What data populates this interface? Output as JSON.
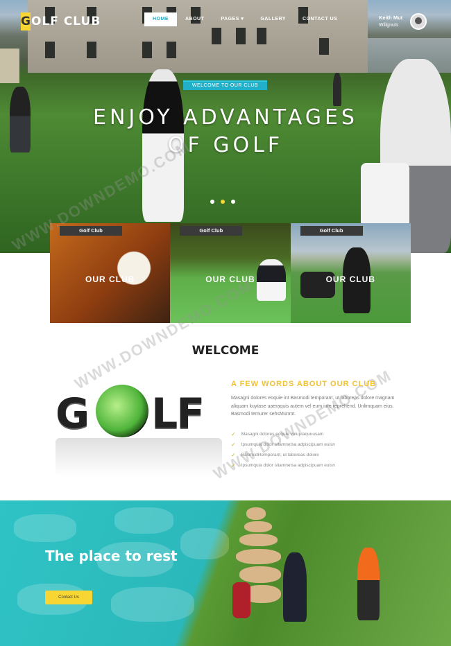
{
  "header": {
    "logo_initial": "G",
    "logo_rest": "OLF CLUB",
    "nav": [
      "HOME",
      "ABOUT",
      "PAGES ▾",
      "GALLERY",
      "CONTACT US"
    ],
    "user_name": "Keith Mut",
    "user_sub": "Willgnuts"
  },
  "hero": {
    "tag": "WELCOME TO OUR CLUB",
    "title_line1": "ENJOY ADVANTAGES",
    "title_line2": "OF GOLF"
  },
  "cards": [
    {
      "label": "Golf Club",
      "caption": "OUR CLUB"
    },
    {
      "label": "Golf Club",
      "caption": "OUR CLUB"
    },
    {
      "label": "Golf Club",
      "caption": "OUR CLUB"
    }
  ],
  "welcome": {
    "heading": "WELCOME",
    "logo_g": "G",
    "logo_lf": "LF",
    "about_title": "A FEW WORDS ABOUT OUR CLUB",
    "about_text": "Masagni dolores eoquie int Basmodi temporant, ut laboreas dolore magnam aliquam kuytase uaeraquis autem vel eum iure reprehend. Unlimquam eius. Basmodi temurer sehsMunmt.",
    "list": [
      "Masagni dolores eoquie voluptaquuusam",
      "Ipsumquia dolor sitamnetsa adpiscipuam euisn",
      "Basmodi temporant, ut laboreas dolore",
      "Ipsumquia dolor sitamnetsa adpiscipuam euisn"
    ]
  },
  "rest": {
    "title": "The place to rest",
    "button": "Contact Us"
  },
  "watermark": "WWW.DOWNDEMO.COM",
  "colors": {
    "accent": "#2aa8c9",
    "yellow": "#f7d533",
    "teal": "#2fc3c5"
  }
}
